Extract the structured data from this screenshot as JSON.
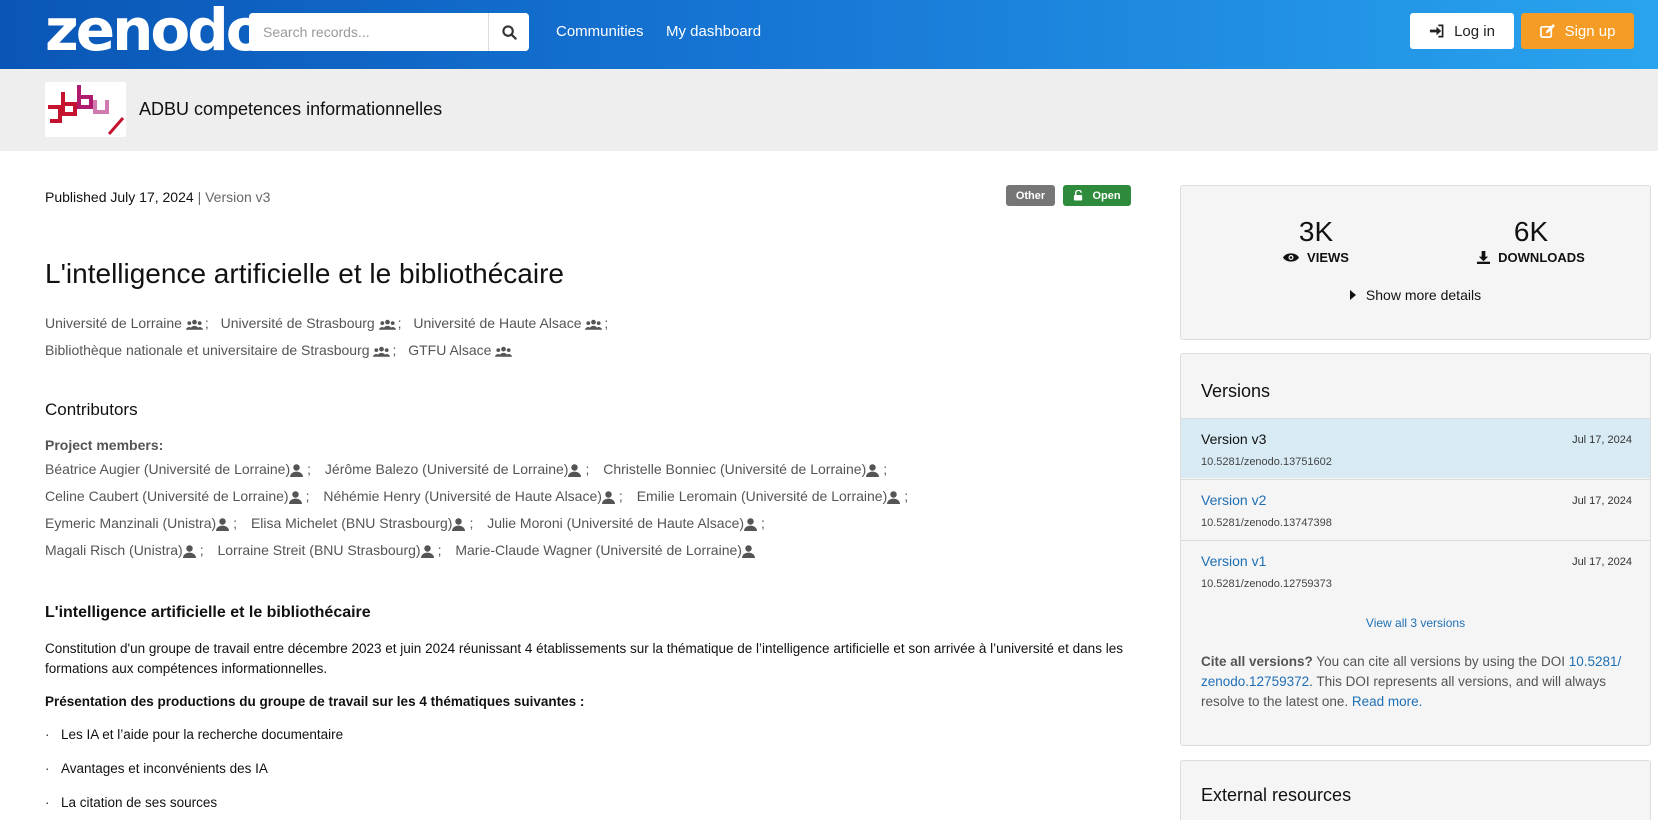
{
  "header": {
    "logo": "zenodo",
    "search_placeholder": "Search records...",
    "nav": [
      "Communities",
      "My dashboard"
    ],
    "login_label": "Log in",
    "signup_label": "Sign up"
  },
  "community": {
    "name": "ADBU competences informationnelles"
  },
  "record": {
    "published": "Published July 17, 2024",
    "version": "| Version v3",
    "badge_type": "Other",
    "badge_access": "Open",
    "title": "L'intelligence artificielle et le bibliothécaire",
    "creators": [
      "Université de Lorraine",
      "Université de Strasbourg",
      "Université de Haute Alsace",
      "Bibliothèque nationale et universitaire de Strasbourg",
      "GTFU Alsace"
    ],
    "contributors_heading": "Contributors",
    "project_members_label": "Project members:",
    "contributors": [
      "Béatrice Augier (Université de Lorraine)",
      "Jérôme Balezo (Université de Lorraine)",
      "Christelle Bonniec (Université de Lorraine)",
      "Celine Caubert (Université de Lorraine)",
      "Néhémie Henry (Université de Haute Alsace)",
      "Emilie Leromain (Université de Lorraine)",
      "Eymeric Manzinali (Unistra)",
      "Elisa Michelet (BNU Strasbourg)",
      "Julie Moroni (Université de Haute Alsace)",
      "Magali Risch (Unistra)",
      "Lorraine Streit (BNU Strasbourg)",
      "Marie-Claude Wagner (Université de Lorraine)"
    ],
    "description_heading": "L'intelligence artificielle et le bibliothécaire",
    "description": "Constitution d'un groupe de travail entre décembre 2023 et juin 2024 réunissant 4 établissements sur la thématique de l’intelligence artificielle et son arrivée à l’université et dans les formations aux compétences informationnelles.",
    "presentation": "Présentation des productions du groupe de travail sur les 4 thématiques suivantes :",
    "bullets": [
      "Les IA et l’aide pour la recherche documentaire",
      "Avantages et inconvénients des IA",
      "La citation de ses sources"
    ]
  },
  "stats": {
    "views": "3K",
    "views_label": "VIEWS",
    "downloads": "6K",
    "downloads_label": "DOWNLOADS",
    "more_details": "Show more details"
  },
  "versions": {
    "heading": "Versions",
    "items": [
      {
        "name": "Version v3",
        "date": "Jul 17, 2024",
        "doi": "10.5281/zenodo.13751602",
        "active": true
      },
      {
        "name": "Version v2",
        "date": "Jul 17, 2024",
        "doi": "10.5281/zenodo.13747398",
        "active": false
      },
      {
        "name": "Version v1",
        "date": "Jul 17, 2024",
        "doi": "10.5281/zenodo.12759373",
        "active": false
      }
    ],
    "view_all": "View all 3 versions",
    "cite_bold": "Cite all versions?",
    "cite_text": " You can cite all versions by using the DOI ",
    "cite_doi": "10.5281/ zenodo.12759372",
    "cite_text2": ". This DOI represents all versions, and will always resolve to the latest one. ",
    "read_more": "Read more."
  },
  "external": {
    "heading": "External resources"
  },
  "colors": {
    "accent": "#1f6fb5",
    "signup": "#f49c25",
    "open_badge": "#2e8b3c"
  }
}
